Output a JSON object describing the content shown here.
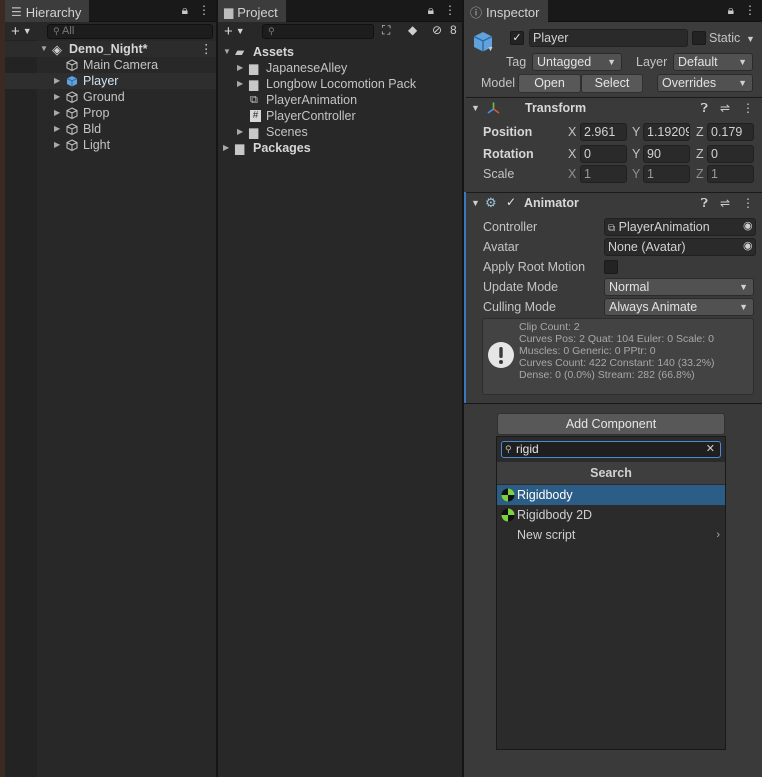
{
  "hierarchy": {
    "tab_label": "Hierarchy",
    "search_placeholder": "All",
    "scene_name": "Demo_Night*",
    "items": [
      {
        "label": "Main Camera"
      },
      {
        "label": "Player"
      },
      {
        "label": "Ground"
      },
      {
        "label": "Prop"
      },
      {
        "label": "Bld"
      },
      {
        "label": "Light"
      }
    ]
  },
  "project": {
    "tab_label": "Project",
    "hidden_count": "8",
    "root": "Assets",
    "assets": [
      {
        "label": "JapaneseAlley",
        "type": "folder"
      },
      {
        "label": "Longbow Locomotion Pack",
        "type": "folder"
      },
      {
        "label": "PlayerAnimation",
        "type": "animator"
      },
      {
        "label": "PlayerController",
        "type": "script"
      },
      {
        "label": "Scenes",
        "type": "folder"
      }
    ],
    "packages": "Packages"
  },
  "inspector": {
    "tab_label": "Inspector",
    "object_name": "Player",
    "active": true,
    "static_label": "Static",
    "tag_label": "Tag",
    "tag_value": "Untagged",
    "layer_label": "Layer",
    "layer_value": "Default",
    "model_label": "Model",
    "open_button": "Open",
    "select_button": "Select",
    "overrides_value": "Overrides",
    "transform": {
      "title": "Transform",
      "position_label": "Position",
      "rotation_label": "Rotation",
      "scale_label": "Scale",
      "position": {
        "x": "2.961",
        "y": "1.19209",
        "z": "0.179"
      },
      "rotation": {
        "x": "0",
        "y": "90",
        "z": "0"
      },
      "scale": {
        "x": "1",
        "y": "1",
        "z": "1"
      },
      "axis_x": "X",
      "axis_y": "Y",
      "axis_z": "Z"
    },
    "animator": {
      "title": "Animator",
      "enabled": true,
      "controller_label": "Controller",
      "controller_value": "PlayerAnimation",
      "avatar_label": "Avatar",
      "avatar_value": "None (Avatar)",
      "apply_root_motion_label": "Apply Root Motion",
      "update_mode_label": "Update Mode",
      "update_mode_value": "Normal",
      "culling_mode_label": "Culling Mode",
      "culling_mode_value": "Always Animate",
      "info_lines": [
        "Clip Count: 2",
        "Curves Pos: 2 Quat: 104 Euler: 0 Scale: 0",
        "Muscles: 0 Generic: 0 PPtr: 0",
        "Curves Count: 422 Constant: 140 (33.2%)",
        "Dense: 0 (0.0%) Stream: 282 (66.8%)"
      ]
    },
    "add_component": {
      "button_label": "Add Component",
      "search_value": "rigid",
      "section_title": "Search",
      "results": [
        {
          "label": "Rigidbody",
          "selected": true
        },
        {
          "label": "Rigidbody 2D",
          "selected": false
        },
        {
          "label": "New script",
          "selected": false
        }
      ]
    }
  },
  "colors": {
    "accent_selected": "#2c5d87",
    "selection_outline": "#3a79bb",
    "panel_bg": "#282828"
  }
}
